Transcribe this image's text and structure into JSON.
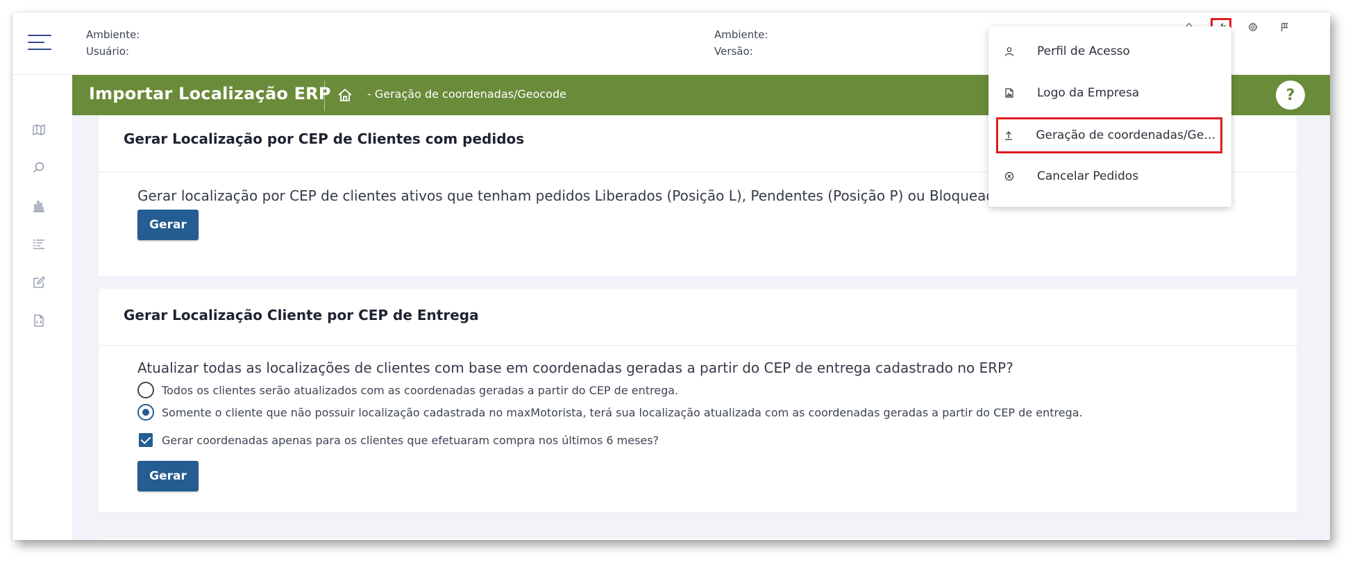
{
  "header": {
    "left_info": {
      "ambiente_label": "Ambiente:",
      "usuario_label": "Usuário:"
    },
    "right_info": {
      "ambiente_label": "Ambiente:",
      "versao_label": "Versão:"
    },
    "icons": [
      "home-icon",
      "wrench-icon",
      "gear-icon",
      "flag-icon"
    ]
  },
  "sidebar": {
    "icons": [
      "map-icon",
      "search-icon",
      "bar-chart-icon",
      "list-filter-icon",
      "edit-icon",
      "code-file-icon"
    ]
  },
  "titlebar": {
    "title": "Importar Localização ERP",
    "breadcrumb": "- Geração de coordenadas/Geocode",
    "help": "?"
  },
  "card1": {
    "title": "Gerar Localização por CEP de Clientes com pedidos",
    "question": "Gerar localização por CEP de clientes ativos que tenham pedidos Liberados (Posição L), Pendentes (Posição P) ou Bloqueados (Posição B)",
    "button": "Gerar"
  },
  "card2": {
    "title": "Gerar Localização Cliente por CEP de Entrega",
    "question": "Atualizar todas as localizações de clientes com base em coordenadas geradas a partir do CEP de entrega cadastrado no ERP?",
    "option_all": "Todos os clientes serão atualizados com as coordenadas geradas a partir do CEP de entrega.",
    "option_missing": "Somente o cliente que não possuir localização cadastrada no maxMotorista, terá sua localização atualizada com as coordenadas geradas a partir do CEP de entrega.",
    "selected_option": "option_missing",
    "checkbox_label": "Gerar coordenadas apenas para os clientes que efetuaram compra nos últimos 6 meses?",
    "checkbox_checked": true,
    "button": "Gerar"
  },
  "dropdown_menu": {
    "items": [
      {
        "label": "Perfil de Acesso",
        "icon": "user-icon"
      },
      {
        "label": "Logo da Empresa",
        "icon": "image-file-icon"
      },
      {
        "label": "Geração de coordenadas/Geocode",
        "icon": "upload-icon",
        "selected": true
      },
      {
        "label": "Cancelar Pedidos",
        "icon": "cancel-circle-icon"
      }
    ]
  },
  "colors": {
    "green": "#6a8b39",
    "button_blue": "#235d91",
    "highlight_red": "#e11b22"
  }
}
